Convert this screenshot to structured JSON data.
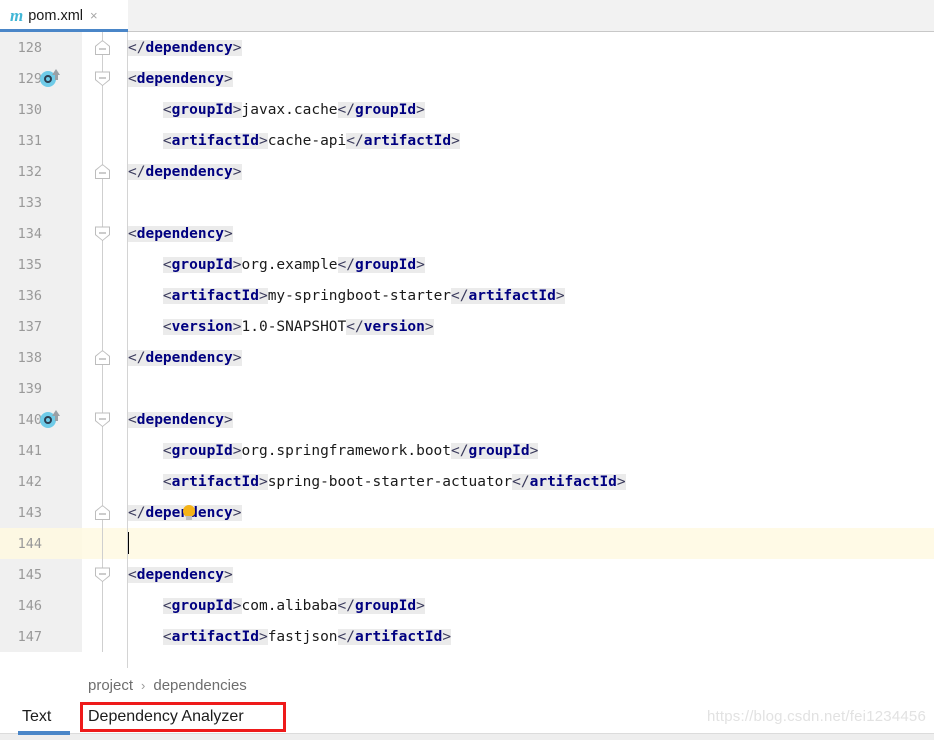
{
  "window": {
    "title": "pom.xml"
  },
  "tabbar": {
    "maven_icon": "m",
    "file_name": "pom.xml",
    "close_glyph": "×"
  },
  "editor": {
    "lines": [
      {
        "number": "128",
        "fold": "up",
        "gutter_icon": null,
        "bulb": false,
        "current": false,
        "indent": 0,
        "tokens": [
          {
            "t": "punct",
            "s": "</"
          },
          {
            "t": "tag",
            "s": "dependency"
          },
          {
            "t": "punct",
            "s": ">"
          }
        ]
      },
      {
        "number": "129",
        "fold": "down",
        "gutter_icon": "maven-dependency-icon",
        "bulb": false,
        "current": false,
        "indent": 0,
        "tokens": [
          {
            "t": "punct",
            "s": "<"
          },
          {
            "t": "tag",
            "s": "dependency"
          },
          {
            "t": "punct",
            "s": ">"
          }
        ]
      },
      {
        "number": "130",
        "fold": null,
        "gutter_icon": null,
        "bulb": false,
        "current": false,
        "indent": 1,
        "tokens": [
          {
            "t": "punct",
            "s": "<"
          },
          {
            "t": "tag",
            "s": "groupId"
          },
          {
            "t": "punct",
            "s": ">"
          },
          {
            "t": "val",
            "s": "javax.cache"
          },
          {
            "t": "punct",
            "s": "</"
          },
          {
            "t": "tag",
            "s": "groupId"
          },
          {
            "t": "punct",
            "s": ">"
          }
        ]
      },
      {
        "number": "131",
        "fold": null,
        "gutter_icon": null,
        "bulb": false,
        "current": false,
        "indent": 1,
        "tokens": [
          {
            "t": "punct",
            "s": "<"
          },
          {
            "t": "tag",
            "s": "artifactId"
          },
          {
            "t": "punct",
            "s": ">"
          },
          {
            "t": "val",
            "s": "cache-api"
          },
          {
            "t": "punct",
            "s": "</"
          },
          {
            "t": "tag",
            "s": "artifactId"
          },
          {
            "t": "punct",
            "s": ">"
          }
        ]
      },
      {
        "number": "132",
        "fold": "up",
        "gutter_icon": null,
        "bulb": false,
        "current": false,
        "indent": 0,
        "tokens": [
          {
            "t": "punct",
            "s": "</"
          },
          {
            "t": "tag",
            "s": "dependency"
          },
          {
            "t": "punct",
            "s": ">"
          }
        ]
      },
      {
        "number": "133",
        "fold": null,
        "gutter_icon": null,
        "bulb": false,
        "current": false,
        "indent": 0,
        "tokens": []
      },
      {
        "number": "134",
        "fold": "down",
        "gutter_icon": null,
        "bulb": false,
        "current": false,
        "indent": 0,
        "tokens": [
          {
            "t": "punct",
            "s": "<"
          },
          {
            "t": "tag",
            "s": "dependency"
          },
          {
            "t": "punct",
            "s": ">"
          }
        ]
      },
      {
        "number": "135",
        "fold": null,
        "gutter_icon": null,
        "bulb": false,
        "current": false,
        "indent": 1,
        "tokens": [
          {
            "t": "punct",
            "s": "<"
          },
          {
            "t": "tag",
            "s": "groupId"
          },
          {
            "t": "punct",
            "s": ">"
          },
          {
            "t": "val",
            "s": "org.example"
          },
          {
            "t": "punct",
            "s": "</"
          },
          {
            "t": "tag",
            "s": "groupId"
          },
          {
            "t": "punct",
            "s": ">"
          }
        ]
      },
      {
        "number": "136",
        "fold": null,
        "gutter_icon": null,
        "bulb": false,
        "current": false,
        "indent": 1,
        "tokens": [
          {
            "t": "punct",
            "s": "<"
          },
          {
            "t": "tag",
            "s": "artifactId"
          },
          {
            "t": "punct",
            "s": ">"
          },
          {
            "t": "val",
            "s": "my-springboot-starter"
          },
          {
            "t": "punct",
            "s": "</"
          },
          {
            "t": "tag",
            "s": "artifactId"
          },
          {
            "t": "punct",
            "s": ">"
          }
        ]
      },
      {
        "number": "137",
        "fold": null,
        "gutter_icon": null,
        "bulb": false,
        "current": false,
        "indent": 1,
        "tokens": [
          {
            "t": "punct",
            "s": "<"
          },
          {
            "t": "tag",
            "s": "version"
          },
          {
            "t": "punct",
            "s": ">"
          },
          {
            "t": "val",
            "s": "1.0-SNAPSHOT"
          },
          {
            "t": "punct",
            "s": "</"
          },
          {
            "t": "tag",
            "s": "version"
          },
          {
            "t": "punct",
            "s": ">"
          }
        ]
      },
      {
        "number": "138",
        "fold": "up",
        "gutter_icon": null,
        "bulb": false,
        "current": false,
        "indent": 0,
        "tokens": [
          {
            "t": "punct",
            "s": "</"
          },
          {
            "t": "tag",
            "s": "dependency"
          },
          {
            "t": "punct",
            "s": ">"
          }
        ]
      },
      {
        "number": "139",
        "fold": null,
        "gutter_icon": null,
        "bulb": false,
        "current": false,
        "indent": 0,
        "tokens": []
      },
      {
        "number": "140",
        "fold": "down",
        "gutter_icon": "maven-dependency-icon",
        "bulb": false,
        "current": false,
        "indent": 0,
        "tokens": [
          {
            "t": "punct",
            "s": "<"
          },
          {
            "t": "tag",
            "s": "dependency"
          },
          {
            "t": "punct",
            "s": ">"
          }
        ]
      },
      {
        "number": "141",
        "fold": null,
        "gutter_icon": null,
        "bulb": false,
        "current": false,
        "indent": 1,
        "tokens": [
          {
            "t": "punct",
            "s": "<"
          },
          {
            "t": "tag",
            "s": "groupId"
          },
          {
            "t": "punct",
            "s": ">"
          },
          {
            "t": "val",
            "s": "org.springframework.boot"
          },
          {
            "t": "punct",
            "s": "</"
          },
          {
            "t": "tag",
            "s": "groupId"
          },
          {
            "t": "punct",
            "s": ">"
          }
        ]
      },
      {
        "number": "142",
        "fold": null,
        "gutter_icon": null,
        "bulb": false,
        "current": false,
        "indent": 1,
        "tokens": [
          {
            "t": "punct",
            "s": "<"
          },
          {
            "t": "tag",
            "s": "artifactId"
          },
          {
            "t": "punct",
            "s": ">"
          },
          {
            "t": "val",
            "s": "spring-boot-starter-actuator"
          },
          {
            "t": "punct",
            "s": "</"
          },
          {
            "t": "tag",
            "s": "artifactId"
          },
          {
            "t": "punct",
            "s": ">"
          }
        ]
      },
      {
        "number": "143",
        "fold": "up",
        "gutter_icon": null,
        "bulb": true,
        "current": false,
        "indent": 0,
        "tokens": [
          {
            "t": "punct",
            "s": "</"
          },
          {
            "t": "tag",
            "s": "dependency"
          },
          {
            "t": "punct",
            "s": ">"
          }
        ]
      },
      {
        "number": "144",
        "fold": null,
        "gutter_icon": null,
        "bulb": false,
        "current": true,
        "indent": 0,
        "tokens": []
      },
      {
        "number": "145",
        "fold": "down",
        "gutter_icon": null,
        "bulb": false,
        "current": false,
        "indent": 0,
        "tokens": [
          {
            "t": "punct",
            "s": "<"
          },
          {
            "t": "tag",
            "s": "dependency"
          },
          {
            "t": "punct",
            "s": ">"
          }
        ]
      },
      {
        "number": "146",
        "fold": null,
        "gutter_icon": null,
        "bulb": false,
        "current": false,
        "indent": 1,
        "tokens": [
          {
            "t": "punct",
            "s": "<"
          },
          {
            "t": "tag",
            "s": "groupId"
          },
          {
            "t": "punct",
            "s": ">"
          },
          {
            "t": "val",
            "s": "com.alibaba"
          },
          {
            "t": "punct",
            "s": "</"
          },
          {
            "t": "tag",
            "s": "groupId"
          },
          {
            "t": "punct",
            "s": ">"
          }
        ]
      },
      {
        "number": "147",
        "fold": null,
        "gutter_icon": null,
        "bulb": false,
        "current": false,
        "indent": 1,
        "tokens": [
          {
            "t": "punct",
            "s": "<"
          },
          {
            "t": "tag",
            "s": "artifactId"
          },
          {
            "t": "punct",
            "s": ">"
          },
          {
            "t": "val",
            "s": "fastjson"
          },
          {
            "t": "punct",
            "s": "</"
          },
          {
            "t": "tag",
            "s": "artifactId"
          },
          {
            "t": "punct",
            "s": ">"
          }
        ]
      }
    ]
  },
  "breadcrumb": {
    "items": [
      "project",
      "dependencies"
    ],
    "separator": "›"
  },
  "bottom_tabs": {
    "text_label": "Text",
    "dependency_analyzer_label": "Dependency Analyzer",
    "active": "Text",
    "highlight_color": "#ee1a1a",
    "active_underline_color": "#4a86c8"
  },
  "watermark": {
    "text": "https://blog.csdn.net/fei1234456"
  }
}
